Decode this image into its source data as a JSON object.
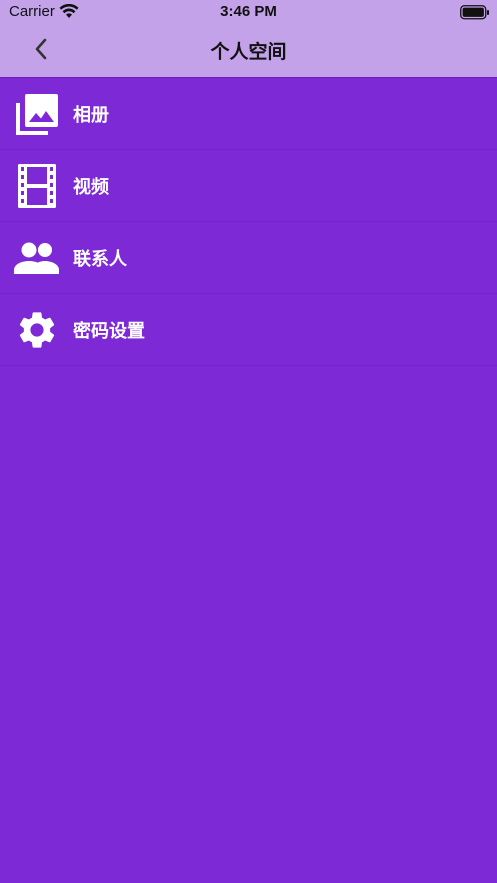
{
  "status_bar": {
    "carrier": "Carrier",
    "time": "3:46 PM"
  },
  "nav": {
    "title": "个人空间",
    "back_icon": "chevron-left-icon"
  },
  "menu": {
    "items": [
      {
        "label": "相册",
        "icon": "photo-library-icon"
      },
      {
        "label": "视频",
        "icon": "film-icon"
      },
      {
        "label": "联系人",
        "icon": "people-icon"
      },
      {
        "label": "密码设置",
        "icon": "gear-icon"
      }
    ]
  },
  "colors": {
    "background": "#7d2ad6",
    "header": "#c3a2ea",
    "text_light": "#ffffff"
  }
}
